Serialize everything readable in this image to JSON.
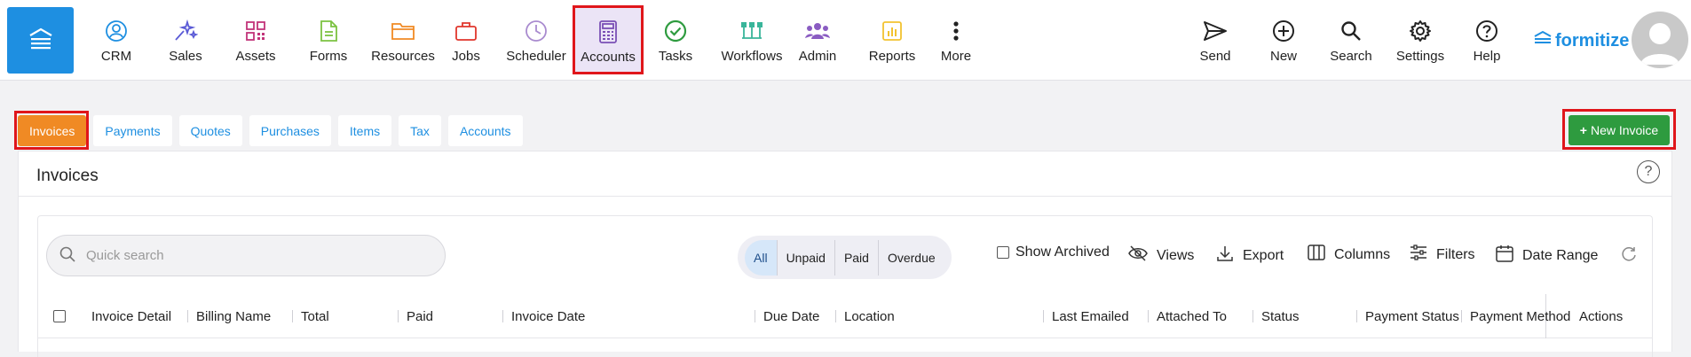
{
  "nav": {
    "items": [
      {
        "label": "CRM",
        "icon": "crm-icon",
        "color": "#1e8fe1"
      },
      {
        "label": "Sales",
        "icon": "sparkle-icon",
        "color": "#5b5bd6"
      },
      {
        "label": "Assets",
        "icon": "qr-code-icon",
        "color": "#c2347a"
      },
      {
        "label": "Forms",
        "icon": "document-icon",
        "color": "#7cc242"
      },
      {
        "label": "Resources",
        "icon": "folder-icon",
        "color": "#f08a24"
      },
      {
        "label": "Jobs",
        "icon": "briefcase-icon",
        "color": "#e0362c"
      },
      {
        "label": "Scheduler",
        "icon": "clock-icon",
        "color": "#a98bcf"
      },
      {
        "label": "Accounts",
        "icon": "calculator-icon",
        "color": "#7a4fb5"
      },
      {
        "label": "Tasks",
        "icon": "check-circle-icon",
        "color": "#2e9b3f"
      },
      {
        "label": "Workflows",
        "icon": "workflow-icon",
        "color": "#39b59a"
      },
      {
        "label": "Admin",
        "icon": "users-icon",
        "color": "#8a5cc2"
      },
      {
        "label": "Reports",
        "icon": "chart-icon",
        "color": "#f2c230"
      },
      {
        "label": "More",
        "icon": "kebab-icon",
        "color": "#222222"
      }
    ],
    "right": [
      {
        "label": "Send",
        "icon": "send-icon"
      },
      {
        "label": "New",
        "icon": "plus-circle-icon"
      },
      {
        "label": "Search",
        "icon": "search-icon"
      },
      {
        "label": "Settings",
        "icon": "gear-icon"
      },
      {
        "label": "Help",
        "icon": "help-icon"
      }
    ],
    "logo": "formitize",
    "active": "Accounts"
  },
  "subtabs": [
    "Invoices",
    "Payments",
    "Quotes",
    "Purchases",
    "Items",
    "Tax",
    "Accounts"
  ],
  "active_subtab": "Invoices",
  "new_invoice_label": "New Invoice",
  "panel": {
    "title": "Invoices",
    "help": "?",
    "search_placeholder": "Quick search",
    "filters": [
      "All",
      "Unpaid",
      "Paid",
      "Overdue"
    ],
    "active_filter": "All",
    "show_archived": "Show Archived",
    "tools": [
      "Views",
      "Export",
      "Columns",
      "Filters",
      "Date Range"
    ]
  },
  "table": {
    "columns": [
      "Invoice Detail",
      "Billing Name",
      "Total",
      "Paid",
      "Invoice Date",
      "Due Date",
      "Location",
      "Last Emailed",
      "Attached To",
      "Status",
      "Payment Status",
      "Payment Method",
      "Actions"
    ]
  },
  "colors": {
    "brand": "#1e8fe1",
    "active_tab": "#f08a24",
    "new_button": "#2e9b3f",
    "highlight": "#e0161b"
  }
}
